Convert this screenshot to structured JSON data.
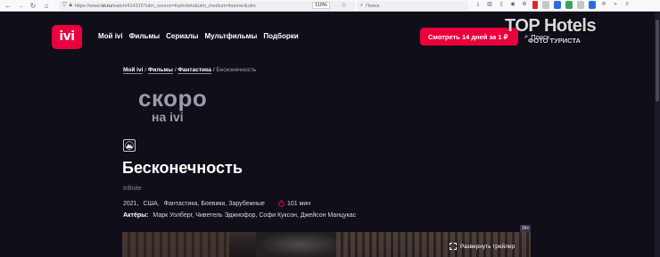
{
  "browser": {
    "url_prefix": "https://www.",
    "url_domain": "ivi.ru",
    "url_path": "/watch/414315?utm_source=tophotels&utm_medium=banner&utm",
    "zoom": "110%",
    "search_placeholder": "Поиск"
  },
  "header": {
    "logo_text": "ivi",
    "menu": [
      "Мой ivi",
      "Фильмы",
      "Сериалы",
      "Мультфильмы",
      "Подборки"
    ],
    "cta_label": "Смотреть 14 дней за 1 ₽",
    "search_label": "Поиск"
  },
  "watermark": {
    "brand": "TOP Hotels",
    "sub": "ФОТО ТУРИСТА"
  },
  "breadcrumb": {
    "items": [
      "Мой ivi",
      "Фильмы",
      "Фантастика"
    ],
    "current": "Бесконечность",
    "separator": "/"
  },
  "soon": {
    "line1": "скоро",
    "line2": "на ivi"
  },
  "movie": {
    "title": "Бесконечность",
    "original_title": "Infinite",
    "year": "2021,",
    "country": "США,",
    "genres": "Фантастика, Боевики, Зарубежные",
    "duration": "101 мин",
    "actors_label": "Актёры:",
    "actors": "Марк Уолберг, Чиветель Эджиофор, Софи Куксон, Джейсон Манцукас",
    "age_rating": "16+"
  },
  "player": {
    "expand_label": "Развернуть трейлер"
  },
  "colors": {
    "brand_red": "#ea003d",
    "bg": "#100e19"
  }
}
